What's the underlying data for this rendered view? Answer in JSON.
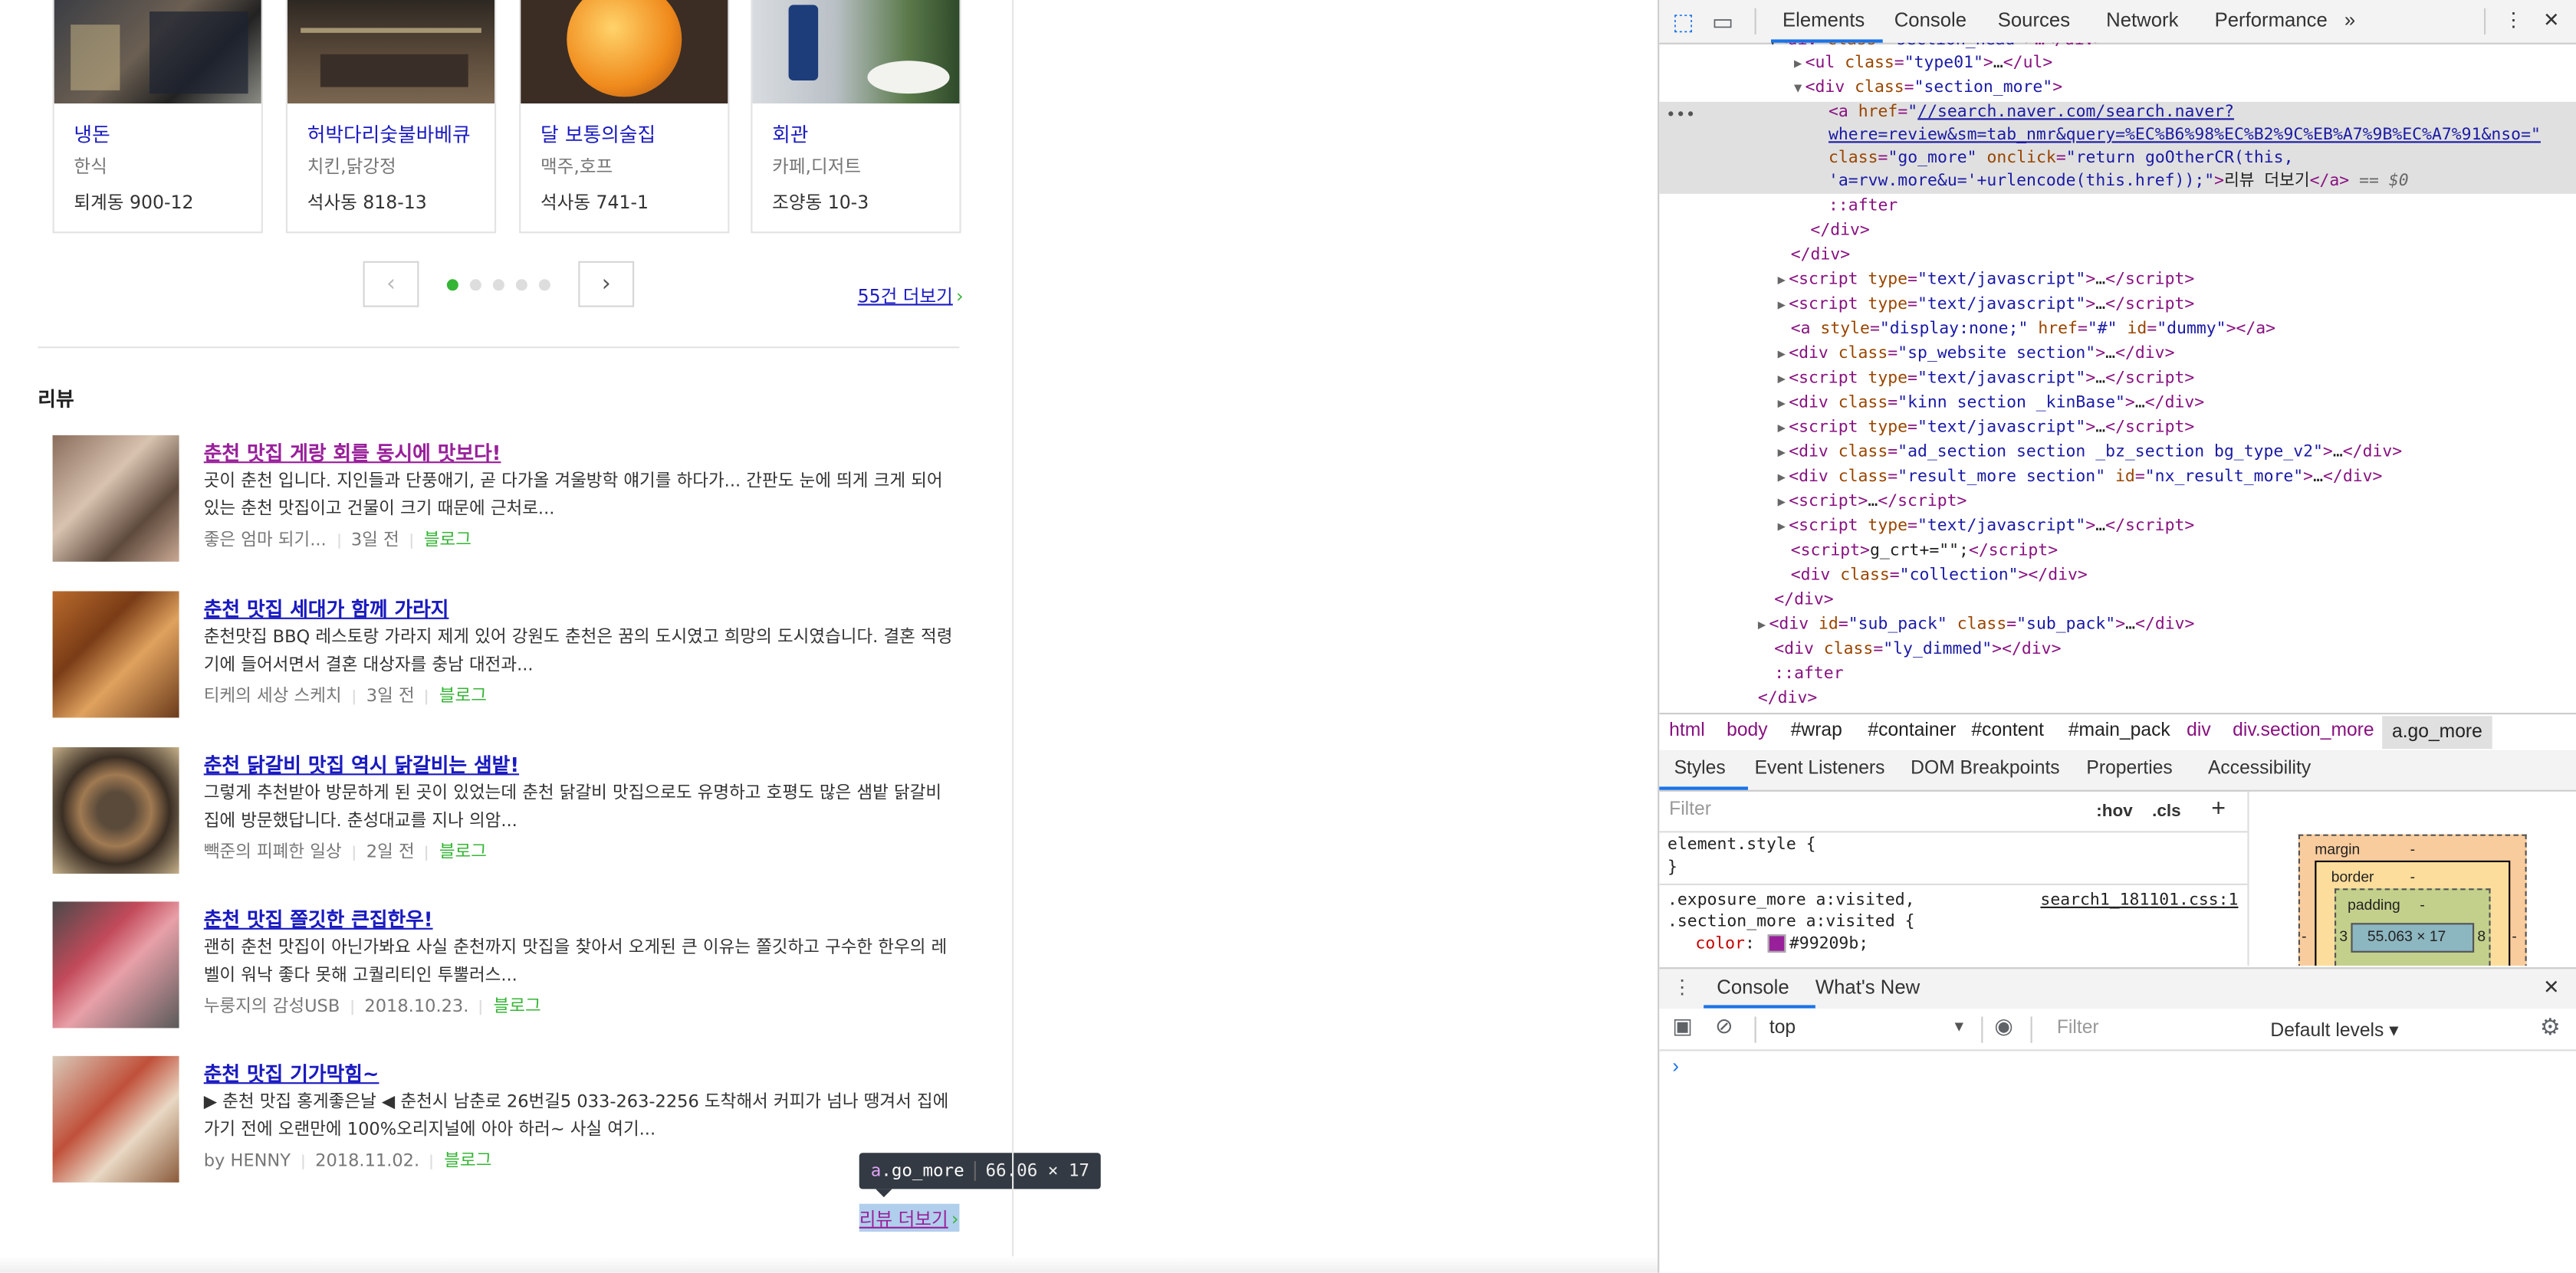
{
  "places": [
    {
      "name": "냉돈",
      "category": "한식",
      "address": "퇴계동 900-12"
    },
    {
      "name": "허박다리숯불바베큐",
      "category": "치킨,닭강정",
      "address": "석사동 818-13"
    },
    {
      "name": "달 보통의술집",
      "category": "맥주,호프",
      "address": "석사동 741-1"
    },
    {
      "name": "회관",
      "category": "카페,디저트",
      "address": "조양동 10-3"
    }
  ],
  "pager": {
    "prev": "‹",
    "next": "›",
    "more": "55건 더보기",
    "more_chev": "›"
  },
  "review_section": {
    "title": "리뷰",
    "items": [
      {
        "title": "춘천 맛집 게랑 회를 동시에 맛보다!",
        "desc": "곳이 춘천 입니다. 지인들과 단풍애기, 곧 다가올 겨울방학 얘기를 하다가... 간판도 눈에 띄게 크게 되어 있는 춘천 맛집이고 건물이 크기 때문에 근처로...",
        "author": "좋은 엄마 되기...",
        "date": "3일 전",
        "type": "블로그"
      },
      {
        "title": "춘천 맛집 세대가 함께 가라지",
        "desc": "춘천맛집 BBQ 레스토랑 가라지 제게 있어 강원도 춘천은 꿈의 도시였고 희망의 도시였습니다. 결혼 적령기에 들어서면서 결혼 대상자를 충남 대전과...",
        "author": "티케의 세상 스케치",
        "date": "3일 전",
        "type": "블로그"
      },
      {
        "title": "춘천 닭갈비 맛집 역시 닭갈비는 샘밭!",
        "desc": "그렇게 추천받아 방문하게 된 곳이 있었는데 춘천 닭갈비 맛집으로도 유명하고 호평도 많은 샘밭 닭갈비 집에 방문했답니다. 춘성대교를 지나 의암...",
        "author": "빽준의 피폐한 일상",
        "date": "2일 전",
        "type": "블로그"
      },
      {
        "title": "춘천 맛집 쫄깃한 큰집한우!",
        "desc": "괜히 춘천 맛집이 아닌가봐요 사실 춘천까지 맛집을 찾아서 오게된 큰 이유는 쫄깃하고 구수한 한우의 레벨이 워낙 좋다 못해 고퀄리티인 투뿔러스...",
        "author": "누룽지의 감성USB",
        "date": "2018.10.23.",
        "type": "블로그"
      },
      {
        "title": "춘천 맛집 기가막힘~",
        "desc": "▶ 춘천 맛집 홍게좋은날 ◀ 춘천시 남춘로 26번길5 033-263-2256 도착해서 커피가 넘나 땡겨서 집에 가기 전에 오랜만에 100%오리지널에 아아 하러~ 사실 여기...",
        "author": "by HENNY",
        "date": "2018.11.02.",
        "type": "블로그"
      }
    ],
    "more": "리뷰 더보기",
    "more_chev": "›"
  },
  "tooltip": {
    "tag": "a",
    "cls": ".go_more",
    "size": "66.06 × 17"
  },
  "devtools": {
    "tabs": [
      "Elements",
      "Console",
      "Sources",
      "Network",
      "Performance"
    ],
    "overflow": "»",
    "menu": "⋮",
    "close": "✕",
    "dom_lines": [
      {
        "indent": 0,
        "html": "<span class='tx'>▼</span>&lt;div class=\"section_head\"&gt;…&lt;/div&gt;"
      }
    ],
    "breadcrumbs": [
      "html",
      "body",
      "#wrap",
      "#container",
      "#content",
      "#main_pack",
      "div",
      "div.section_more",
      "a.go_more"
    ],
    "subtabs": [
      "Styles",
      "Event Listeners",
      "DOM Breakpoints",
      "Properties",
      "Accessibility"
    ],
    "filter_placeholder": "Filter",
    "hov": ":hov",
    "cls": ".cls",
    "plus": "+",
    "style_rules": {
      "element_style": "element.style {",
      "close": "}",
      "sel1": ".exposure_more a:visited,",
      "sel2": ".section_more a:visited {",
      "source": "search1_181101.css:1",
      "prop": "color",
      "value": "#99209b;"
    },
    "box_model": {
      "margin": "margin",
      "border": "border",
      "padding": "padding",
      "dash": "-",
      "content": "55.063 × 17",
      "left": "3",
      "right": "8"
    },
    "drawer_tabs": [
      "Console",
      "What's New"
    ],
    "console_context": "top",
    "console_filter": "Filter",
    "log_levels": "Default levels ▾",
    "prompt": "›"
  }
}
